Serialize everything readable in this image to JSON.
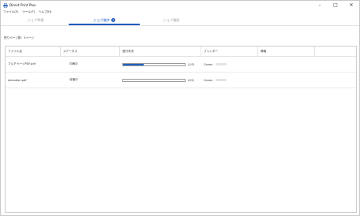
{
  "window": {
    "title": "Direct Print Plus",
    "controls": {
      "minimize": "–",
      "maximize": "□",
      "close": "✕"
    }
  },
  "menu": {
    "items": [
      {
        "label": "ファイル(F)"
      },
      {
        "label": "ツール(T)"
      },
      {
        "label": "ヘルプ(H)"
      }
    ]
  },
  "tabs": {
    "items": [
      {
        "label": "ジョブ準備"
      },
      {
        "label": "ジョブ進捗",
        "badge": "2"
      },
      {
        "label": "ジョブ履歴"
      }
    ],
    "active_index": 1,
    "accent_color": "#1e5bbf",
    "inactive_color": "#a8a8a8"
  },
  "summary": {
    "text": "残りページ数：3ページ"
  },
  "table": {
    "headers": {
      "file": "ファイル名",
      "status": "ステータス",
      "progress": "進行状況",
      "printer": "プリンター",
      "info": "情報"
    },
    "rows": [
      {
        "file": "マルチページPDF.pdf",
        "status": "印刷中",
        "progress_fraction": 0.33,
        "progress_text": "(1/3)",
        "printer": "Canon"
      },
      {
        "file": "elevation.pdf",
        "status": "待機中",
        "progress_fraction": 0,
        "progress_text": "(0/1)",
        "printer": "Canon"
      }
    ]
  },
  "icons": {
    "app": "printer-icon"
  },
  "colors": {
    "progress_fill": "#1f5fbf"
  }
}
